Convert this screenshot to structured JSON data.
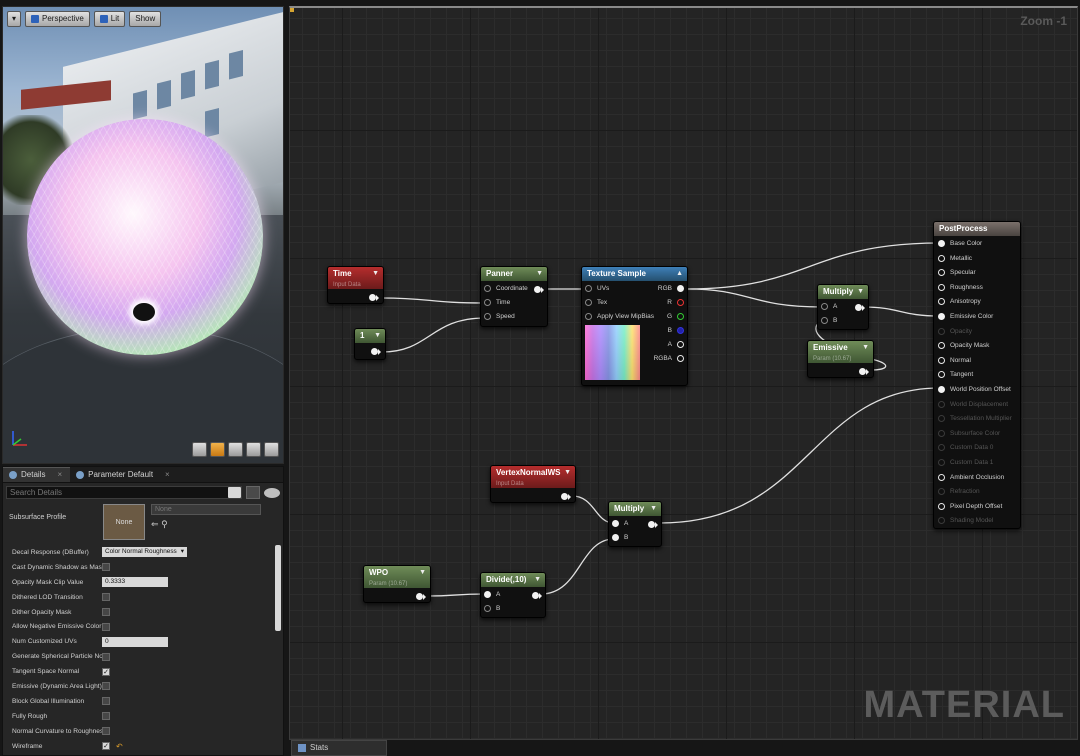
{
  "viewport": {
    "toolbar": {
      "perspective_label": "Perspective",
      "lit_label": "Lit",
      "show_label": "Show"
    }
  },
  "details": {
    "tabs": [
      {
        "label": "Details"
      },
      {
        "label": "Parameter Default"
      }
    ],
    "search_placeholder": "Search Details",
    "subsurface": {
      "label": "Subsurface Profile",
      "thumb_text": "None",
      "combo_value": "None"
    },
    "properties": [
      {
        "label": "Decal Response (DBuffer)",
        "kind": "combo",
        "value": "Color Normal Roughness"
      },
      {
        "label": "Cast Dynamic Shadow as Masked",
        "kind": "check",
        "checked": false
      },
      {
        "label": "Opacity Mask Clip Value",
        "kind": "number",
        "value": "0.3333"
      },
      {
        "label": "Dithered LOD Transition",
        "kind": "check",
        "checked": false
      },
      {
        "label": "Dither Opacity Mask",
        "kind": "check",
        "checked": false
      },
      {
        "label": "Allow Negative Emissive Color",
        "kind": "check",
        "checked": false
      },
      {
        "label": "Num Customized UVs",
        "kind": "number",
        "value": "0"
      },
      {
        "label": "Generate Spherical Particle Normals",
        "kind": "check",
        "checked": false
      },
      {
        "label": "Tangent Space Normal",
        "kind": "check",
        "checked": true
      },
      {
        "label": "Emissive (Dynamic Area Light)",
        "kind": "check",
        "checked": false
      },
      {
        "label": "Block Global Illumination",
        "kind": "check",
        "checked": false
      },
      {
        "label": "Fully Rough",
        "kind": "check",
        "checked": false
      },
      {
        "label": "Normal Curvature to Roughness",
        "kind": "check",
        "checked": false
      },
      {
        "label": "Wireframe",
        "kind": "check",
        "checked": true
      }
    ]
  },
  "graph": {
    "zoom_label": "Zoom -1",
    "watermark": "MATERIAL",
    "bottom_tab": "Stats",
    "nodes": {
      "time": {
        "title": "Time",
        "subtitle": "Input Data"
      },
      "const1": {
        "title": "1"
      },
      "panner": {
        "title": "Panner",
        "pins": [
          "Coordinate",
          "Time",
          "Speed"
        ]
      },
      "texture": {
        "title": "Texture Sample",
        "pins_in": [
          "UVs",
          "Tex",
          "Apply View MipBias"
        ],
        "pins_out": [
          "RGB",
          "R",
          "G",
          "B",
          "A",
          "RGBA"
        ]
      },
      "multiply1": {
        "title": "Multiply",
        "pins": [
          "A",
          "B"
        ]
      },
      "emissive": {
        "title": "Emissive",
        "subtitle": "Param (10.67)"
      },
      "vertex": {
        "title": "VertexNormalWS",
        "subtitle": "Input Data"
      },
      "multiply2": {
        "title": "Multiply",
        "pins": [
          "A",
          "B"
        ]
      },
      "wpo": {
        "title": "WPO",
        "subtitle": "Param (10.67)"
      },
      "divide": {
        "title": "Divide(,10)",
        "pins": [
          "A",
          "B"
        ]
      },
      "postprocess": {
        "title": "PostProcess",
        "pins": [
          {
            "label": "Base Color",
            "active": true,
            "connected": true
          },
          {
            "label": "Metallic",
            "active": true,
            "connected": false
          },
          {
            "label": "Specular",
            "active": true,
            "connected": false
          },
          {
            "label": "Roughness",
            "active": true,
            "connected": false
          },
          {
            "label": "Anisotropy",
            "active": true,
            "connected": false
          },
          {
            "label": "Emissive Color",
            "active": true,
            "connected": true
          },
          {
            "label": "Opacity",
            "active": false,
            "connected": false
          },
          {
            "label": "Opacity Mask",
            "active": true,
            "connected": false
          },
          {
            "label": "Normal",
            "active": true,
            "connected": false
          },
          {
            "label": "Tangent",
            "active": true,
            "connected": false
          },
          {
            "label": "World Position Offset",
            "active": true,
            "connected": true
          },
          {
            "label": "World Displacement",
            "active": false,
            "connected": false
          },
          {
            "label": "Tessellation Multiplier",
            "active": false,
            "connected": false
          },
          {
            "label": "Subsurface Color",
            "active": false,
            "connected": false
          },
          {
            "label": "Custom Data 0",
            "active": false,
            "connected": false
          },
          {
            "label": "Custom Data 1",
            "active": false,
            "connected": false
          },
          {
            "label": "Ambient Occlusion",
            "active": true,
            "connected": false
          },
          {
            "label": "Refraction",
            "active": false,
            "connected": false
          },
          {
            "label": "Pixel Depth Offset",
            "active": true,
            "connected": false
          },
          {
            "label": "Shading Model",
            "active": false,
            "connected": false
          }
        ]
      }
    }
  },
  "colors": {
    "accent": "#d6a531",
    "param_green": "#5f7d4a",
    "input_red": "#9e2525",
    "texture_blue": "#3473a8"
  }
}
